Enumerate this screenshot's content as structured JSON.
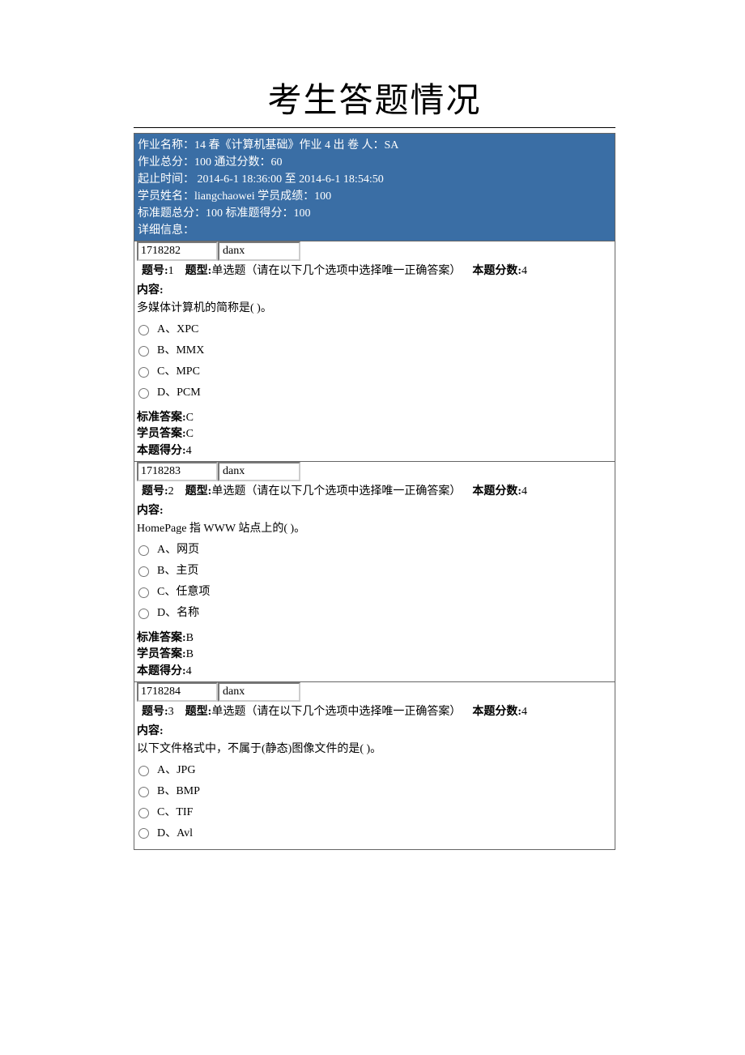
{
  "title": "考生答题情况",
  "header": {
    "line1_label1": "作业名称：",
    "line1_val1": "14 春《计算机基础》作业 4",
    "line1_label2": "  出 卷 人：",
    "line1_val2": "SA",
    "line2_label1": "作业总分：",
    "line2_val1": "100",
    "line2_label2": "  通过分数：",
    "line2_val2": "60",
    "line3_label": "起止时间：",
    "line3_val": " 2014-6-1 18:36:00 至 2014-6-1 18:54:50",
    "line4_label1": "学员姓名：",
    "line4_val1": "liangchaowei",
    "line4_label2": "  学员成绩：",
    "line4_val2": "100",
    "line5_label1": "标准题总分：",
    "line5_val1": "100",
    "line5_label2": "  标准题得分：",
    "line5_val2": "100",
    "line6": "详细信息："
  },
  "labels": {
    "qnum": "题号:",
    "qtype": "题型:",
    "single_choice": "单选题（请在以下几个选项中选择唯一正确答案）",
    "qscore": "本题分数:",
    "content": "内容:",
    "std_answer": "标准答案:",
    "stu_answer": "学员答案:",
    "got_score": "本题得分:"
  },
  "questions": [
    {
      "id": "1718282",
      "typecode": "danx",
      "num": "1",
      "score": "4",
      "content": "多媒体计算机的简称是( )。",
      "options": [
        "A、XPC",
        "B、MMX",
        "C、MPC",
        "D、PCM"
      ],
      "std_answer": "C",
      "stu_answer": "C",
      "got": "4"
    },
    {
      "id": "1718283",
      "typecode": "danx",
      "num": "2",
      "score": "4",
      "content": "HomePage 指 WWW 站点上的( )。",
      "options": [
        "A、网页",
        "B、主页",
        "C、任意项",
        "D、名称"
      ],
      "std_answer": "B",
      "stu_answer": "B",
      "got": "4"
    },
    {
      "id": "1718284",
      "typecode": "danx",
      "num": "3",
      "score": "4",
      "content": "以下文件格式中，不属于(静态)图像文件的是( )。",
      "options": [
        "A、JPG",
        "B、BMP",
        "C、TIF",
        "D、Avl"
      ],
      "std_answer": "",
      "stu_answer": "",
      "got": ""
    }
  ]
}
